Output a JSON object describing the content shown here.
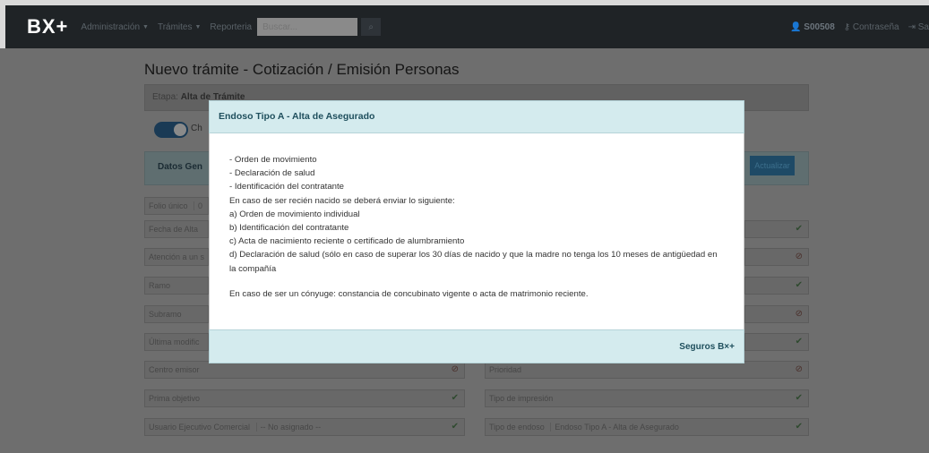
{
  "navbar": {
    "brand": "BX+",
    "menu": [
      {
        "label": "Administración"
      },
      {
        "label": "Trámites"
      },
      {
        "label": "Reporteria"
      }
    ],
    "search_placeholder": "Buscar...",
    "user": "S00508",
    "password_label": "Contraseña",
    "logout_label": "Sa"
  },
  "page": {
    "title": "Nuevo trámite - Cotización / Emisión Personas",
    "etapa_label": "Etapa:",
    "etapa_value": "Alta de Trámite",
    "toggle_label": "Ch",
    "datos_label": "Datos Gen",
    "actualizar": "Actualizar",
    "left_fields": [
      {
        "label": "Folio único",
        "value": "0"
      },
      {
        "label": "Fecha de Alta",
        "value": ""
      },
      {
        "label": "Atención a un s",
        "value": ""
      },
      {
        "label": "Ramo",
        "value": ""
      },
      {
        "label": "Subramo",
        "value": ""
      },
      {
        "label": "Última modific",
        "value": ""
      },
      {
        "label": "Centro emisor",
        "value": ""
      },
      {
        "label": "Prima objetivo",
        "value": ""
      },
      {
        "label": "Usuario Ejecutivo Comercial",
        "value": "-- No asignado --"
      }
    ],
    "right_fields": [
      {
        "label": "Prioridad",
        "value": ""
      },
      {
        "label": "Tipo de impresión",
        "value": ""
      },
      {
        "label": "Tipo de endoso",
        "value": "Endoso Tipo A - Alta de Asegurado"
      }
    ]
  },
  "modal": {
    "title": "Endoso Tipo A - Alta de Asegurado",
    "lines": [
      "- Orden de movimiento",
      "- Declaración de salud",
      "- Identificación del contratante",
      "En caso de ser recién nacido se deberá enviar lo siguiente:",
      "a) Orden de movimiento individual",
      "b) Identificación del contratante",
      "c) Acta de nacimiento reciente o certificado de alumbramiento",
      "d) Declaración de salud (sólo en caso de superar los 30 días de nacido y que la madre no tenga los 10 meses de antigüedad en la compañía"
    ],
    "last_line": "En caso de ser un cónyuge: constancia de concubinato vigente o acta de matrimonio reciente.",
    "footer": "Seguros B×+"
  },
  "icons": {
    "ok": "check-icon",
    "warn": "ban-icon"
  }
}
